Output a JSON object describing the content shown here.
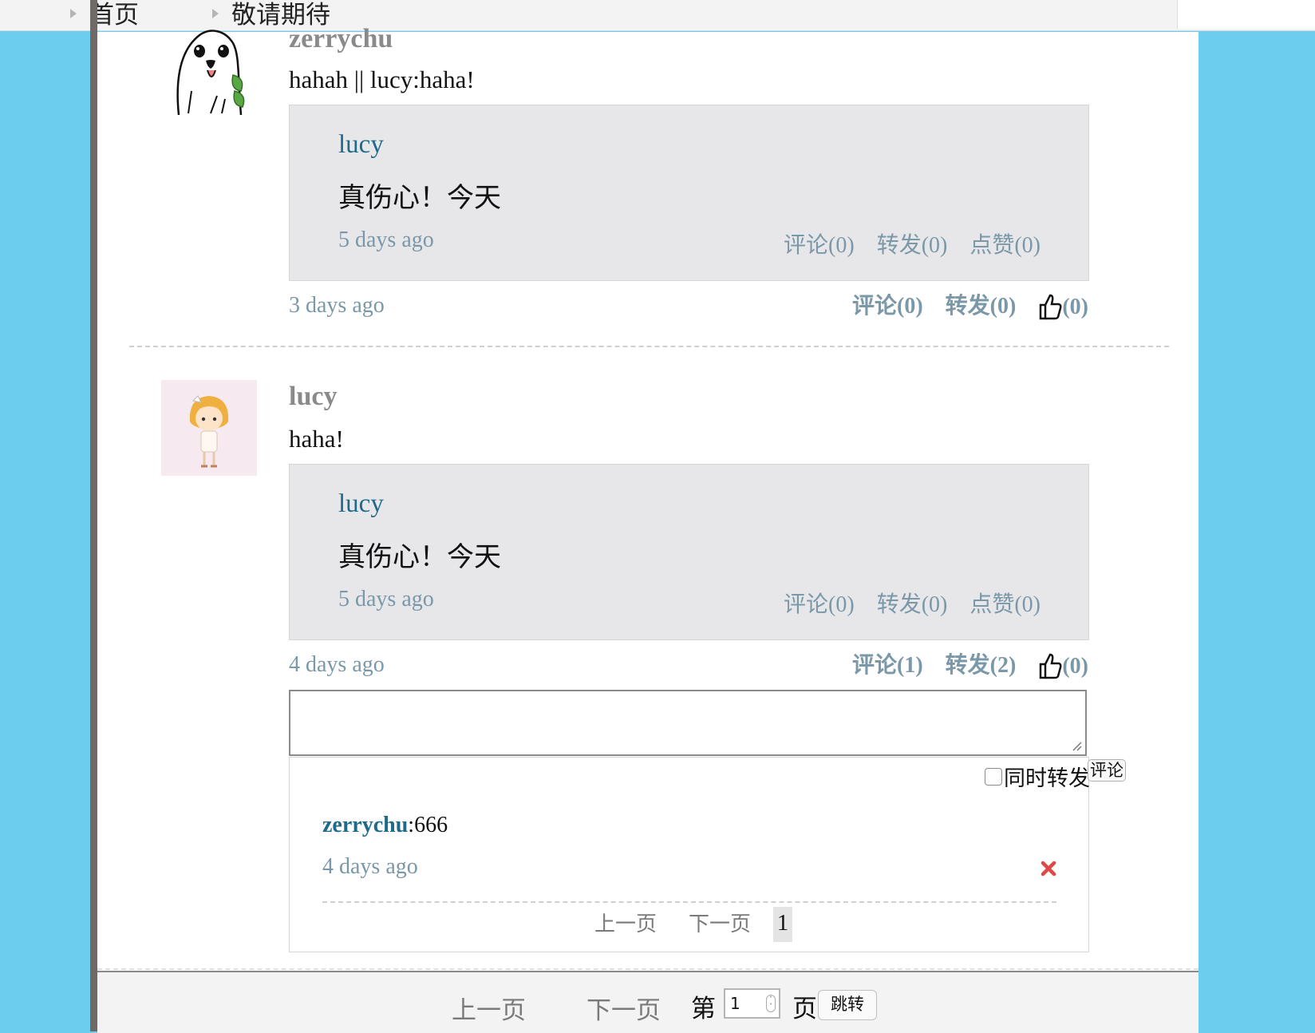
{
  "nav": {
    "items": [
      "首页",
      "敬请期待"
    ]
  },
  "posts": [
    {
      "username": "zerrychu",
      "avatar": "seal-avatar",
      "text": "hahah || lucy:haha!",
      "quote": {
        "user": "lucy",
        "text": "真伤心！今天",
        "time": "5 days ago",
        "comment": "评论(0)",
        "forward": "转发(0)",
        "like": "点赞(0)"
      },
      "time": "3 days ago",
      "comment": "评论(0)",
      "forward": "转发(0)",
      "like_count": "(0)"
    },
    {
      "username": "lucy",
      "avatar": "girl-avatar",
      "text": "haha!",
      "quote": {
        "user": "lucy",
        "text": "真伤心！今天",
        "time": "5 days ago",
        "comment": "评论(0)",
        "forward": "转发(0)",
        "like": "点赞(0)"
      },
      "time": "4 days ago",
      "comment": "评论(1)",
      "forward": "转发(2)",
      "like_count": "(0)"
    }
  ],
  "comment_box": {
    "value": "",
    "forward_option": "同时转发",
    "forward_checked": false,
    "submit_label": "评论"
  },
  "comments": [
    {
      "user": "zerrychu",
      "text": ":666",
      "time": "4 days ago"
    }
  ],
  "comment_pager": {
    "prev": "上一页",
    "next": "下一页",
    "current": "1"
  },
  "pager": {
    "prev": "上一页",
    "next": "下一页",
    "page_prefix": "第",
    "page_value": "1",
    "page_suffix": "页",
    "jump": "跳转"
  },
  "colors": {
    "background": "#6dcdee",
    "link": "#1e6a8a",
    "meta": "#7a98a8",
    "quote_bg": "#e7e7ea"
  }
}
